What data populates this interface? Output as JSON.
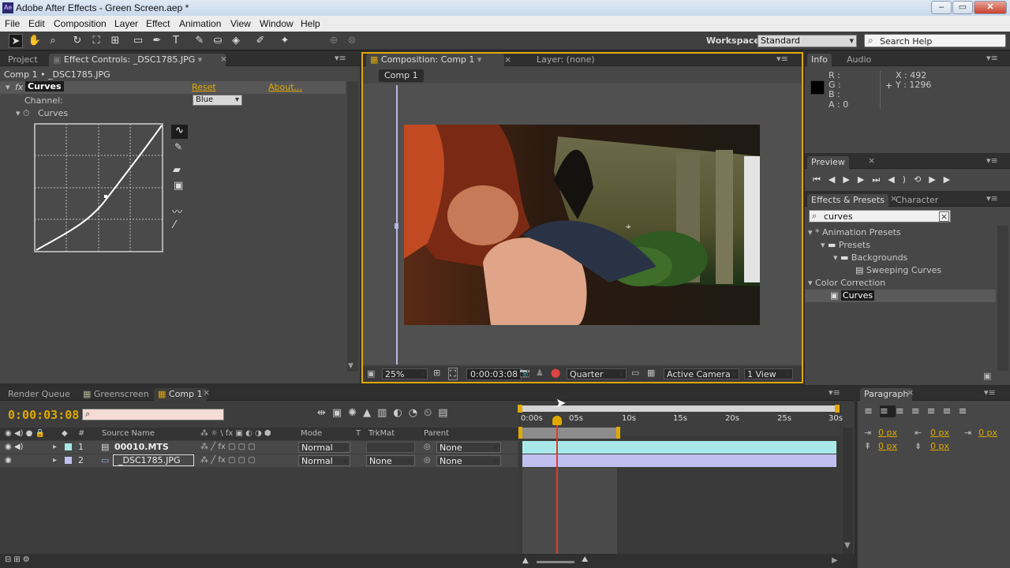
{
  "window": {
    "title": "Adobe After Effects - Green Screen.aep *",
    "app_icon": "Ae"
  },
  "menu": [
    "File",
    "Edit",
    "Composition",
    "Layer",
    "Effect",
    "Animation",
    "View",
    "Window",
    "Help"
  ],
  "workspace": {
    "label": "Workspace:",
    "value": "Standard"
  },
  "search_help": {
    "placeholder": "Search Help"
  },
  "effect_controls": {
    "tab_project": "Project",
    "tab": "Effect Controls: _DSC1785.JPG",
    "breadcrumb": "Comp 1 • _DSC1785.JPG",
    "effect_name": "Curves",
    "reset": "Reset",
    "about": "About...",
    "channel_label": "Channel:",
    "channel_value": "Blue",
    "curves_label": "Curves"
  },
  "composition": {
    "tab": "Composition: Comp 1",
    "layer_tab": "Layer: (none)",
    "comp_button": "Comp 1",
    "zoom": "25%",
    "timecode": "0:00:03:08",
    "resolution": "Quarter",
    "camera": "Active Camera",
    "view": "1 View"
  },
  "info": {
    "tab": "Info",
    "tab2": "Audio",
    "r": "R :",
    "g": "G :",
    "b": "B :",
    "a": "A : 0",
    "x": "X : 492",
    "y": "Y : 1296"
  },
  "preview": {
    "tab": "Preview"
  },
  "effects_presets": {
    "tab": "Effects & Presets",
    "tab2": "Character",
    "search": "curves",
    "tree": [
      {
        "label": "* Animation Presets",
        "depth": 0
      },
      {
        "label": "Presets",
        "depth": 1
      },
      {
        "label": "Backgrounds",
        "depth": 2
      },
      {
        "label": "Sweeping Curves",
        "depth": 3
      },
      {
        "label": "Color Correction",
        "depth": 0
      },
      {
        "label": "Curves",
        "depth": 1
      }
    ]
  },
  "timeline": {
    "tabs": [
      "Render Queue",
      "Greenscreen",
      "Comp 1"
    ],
    "timecode": "0:00:03:08",
    "columns": {
      "num": "#",
      "source": "Source Name",
      "mode": "Mode",
      "t": "T",
      "trkmat": "TrkMat",
      "parent": "Parent"
    },
    "layers": [
      {
        "num": "1",
        "name": "00010.MTS",
        "mode": "Normal",
        "trkmat": "",
        "parent": "None"
      },
      {
        "num": "2",
        "name": "_DSC1785.JPG",
        "mode": "Normal",
        "trkmat": "None",
        "parent": "None"
      }
    ],
    "ruler": [
      "0:00s",
      "05s",
      "10s",
      "15s",
      "20s",
      "25s",
      "30s"
    ],
    "playhead_seconds": 3.33
  },
  "paragraph": {
    "tab": "Paragraph",
    "px1": "0 px",
    "px2": "0 px",
    "px3": "0 px",
    "px4": "0 px",
    "px5": "0 px"
  },
  "colors": {
    "accent": "#e1a800",
    "layer1": "#a8e8e8",
    "layer2": "#c0c0f0",
    "playhead": "#e03a2a"
  }
}
